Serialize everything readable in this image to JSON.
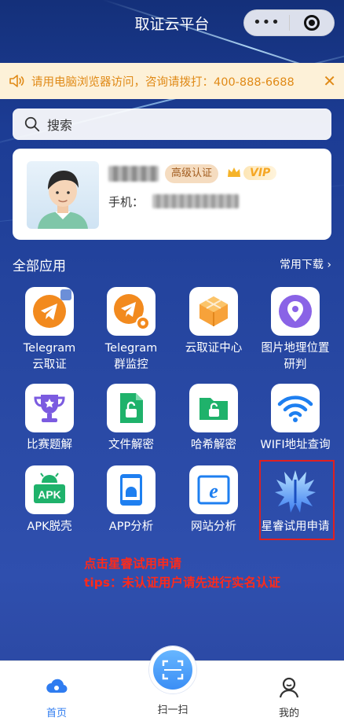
{
  "titlebar": {
    "title": "取证云平台",
    "capsule_dots": "•••"
  },
  "notice": {
    "text": "请用电脑浏览器访问，咨询请拨打：400-888-6688",
    "close": "✕"
  },
  "search": {
    "placeholder": "搜索"
  },
  "profile": {
    "level_badge": "高级认证",
    "vip_label": "VIP",
    "phone_label": "手机："
  },
  "section": {
    "title": "全部应用",
    "more": "常用下载 ›"
  },
  "apps": [
    {
      "label_line1": "Telegram",
      "label_line2": "云取证",
      "icon": "telegram-icon"
    },
    {
      "label_line1": "Telegram",
      "label_line2": "群监控",
      "icon": "telegram-eye-icon"
    },
    {
      "label_line1": "云取证中心",
      "label_line2": "",
      "icon": "cube-icon"
    },
    {
      "label_line1": "图片地理位置",
      "label_line2": "研判",
      "icon": "location-pin-icon"
    },
    {
      "label_line1": "比赛题解",
      "label_line2": "",
      "icon": "trophy-icon"
    },
    {
      "label_line1": "文件解密",
      "label_line2": "",
      "icon": "file-unlock-icon"
    },
    {
      "label_line1": "哈希解密",
      "label_line2": "",
      "icon": "folder-unlock-icon"
    },
    {
      "label_line1": "WIFI地址查询",
      "label_line2": "",
      "icon": "wifi-icon"
    },
    {
      "label_line1": "APK脱壳",
      "label_line2": "",
      "icon": "apk-icon"
    },
    {
      "label_line1": "APP分析",
      "label_line2": "",
      "icon": "android-phone-icon"
    },
    {
      "label_line1": "网站分析",
      "label_line2": "",
      "icon": "browser-icon"
    },
    {
      "label_line1": "星睿试用申请",
      "label_line2": "",
      "icon": "xingrui-logo-icon"
    }
  ],
  "instructions": {
    "line1": "点击星睿试用申请",
    "line2": "tips：未认证用户请先进行实名认证"
  },
  "tabbar": {
    "home": "首页",
    "scan": "扫一扫",
    "mine": "我的"
  },
  "colors": {
    "accent": "#2f7cf0",
    "notice_text": "#e08a17",
    "note_red": "#ff2a1a",
    "highlight_border": "#e02020"
  }
}
